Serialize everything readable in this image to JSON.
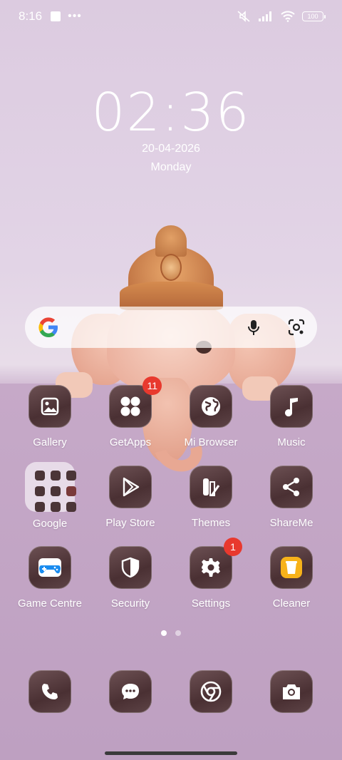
{
  "status_bar": {
    "time": "8:16",
    "battery": "100",
    "icons": [
      "notification-square-icon",
      "more-dots-icon",
      "mute-icon",
      "signal-icon",
      "wifi-icon",
      "battery-icon"
    ]
  },
  "lockclock": {
    "time": "02:36",
    "date": "20-04-2026",
    "day": "Monday"
  },
  "search": {
    "icons": [
      "google-logo-icon",
      "mic-icon",
      "google-lens-icon"
    ]
  },
  "apps": [
    {
      "label": "Gallery",
      "icon": "gallery-icon",
      "badge": ""
    },
    {
      "label": "GetApps",
      "icon": "getapps-icon",
      "badge": "11"
    },
    {
      "label": "Mi Browser",
      "icon": "globe-icon",
      "badge": ""
    },
    {
      "label": "Music",
      "icon": "music-note-icon",
      "badge": ""
    },
    {
      "label": "Google",
      "icon": "folder-icon",
      "badge": ""
    },
    {
      "label": "Play Store",
      "icon": "play-store-icon",
      "badge": ""
    },
    {
      "label": "Themes",
      "icon": "themes-icon",
      "badge": ""
    },
    {
      "label": "ShareMe",
      "icon": "share-icon",
      "badge": ""
    },
    {
      "label": "Game Centre",
      "icon": "gamepad-icon",
      "badge": ""
    },
    {
      "label": "Security",
      "icon": "shield-icon",
      "badge": ""
    },
    {
      "label": "Settings",
      "icon": "gear-icon",
      "badge": "1"
    },
    {
      "label": "Cleaner",
      "icon": "trash-icon",
      "badge": ""
    }
  ],
  "dock": [
    {
      "icon": "phone-icon"
    },
    {
      "icon": "messages-icon"
    },
    {
      "icon": "chrome-icon"
    },
    {
      "icon": "camera-icon"
    }
  ],
  "colors": {
    "badge": "#e8392e",
    "icon_bg": "#4a3033",
    "wallpaper": "#c6a9c8"
  }
}
